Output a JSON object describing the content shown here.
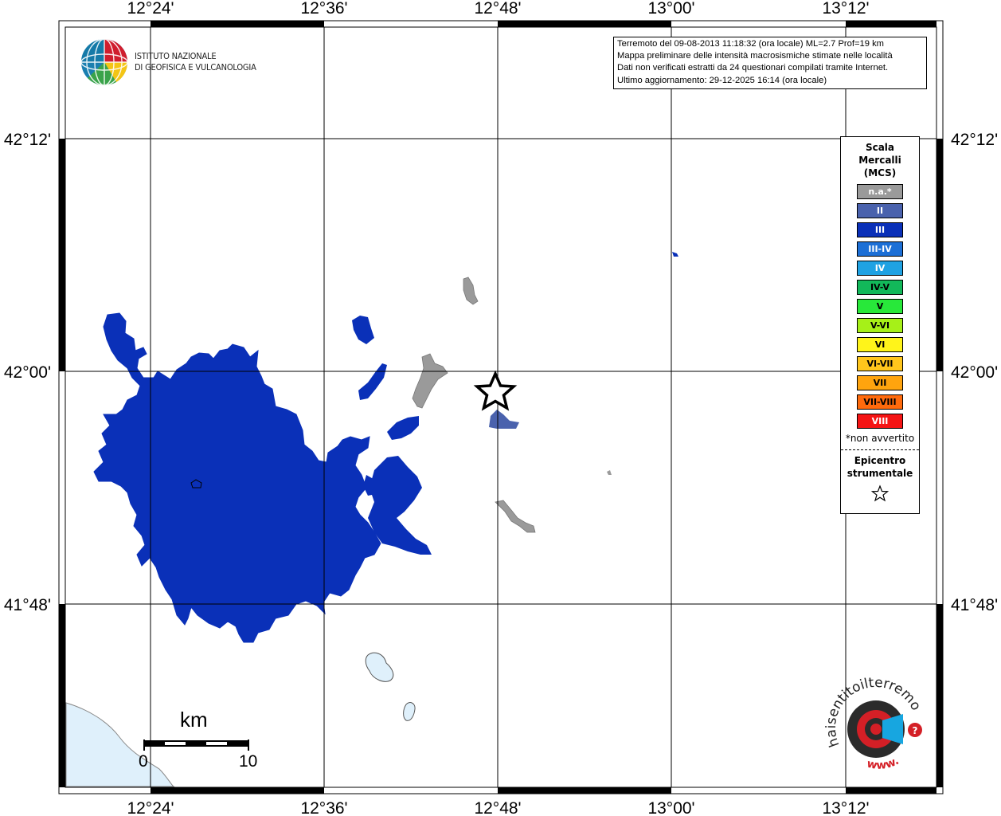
{
  "map": {
    "lon_labels": [
      "12°24'",
      "12°36'",
      "12°48'",
      "13°00'",
      "13°12'"
    ],
    "lat_labels": [
      "42°12'",
      "42°00'",
      "41°48'"
    ]
  },
  "logo": {
    "line1": "ISTITUTO NAZIONALE",
    "line2": "DI GEOFISICA E VULCANOLOGIA"
  },
  "info": {
    "line1": "Terremoto del 09-08-2013 11:18:32 (ora locale) ML=2.7 Prof=19 km",
    "line2": "Mappa preliminare delle intensità macrosismiche stimate nelle località",
    "line3": "Dati non verificati estratti da 24 questionari compilati tramite Internet.",
    "line4": "Ultimo aggiornamento: 29-12-2025 16:14 (ora locale)"
  },
  "legend": {
    "title_line1": "Scala",
    "title_line2": "Mercalli",
    "title_line3": "(MCS)",
    "items": [
      {
        "label": "n.a.*",
        "color": "#9a9a9a",
        "text_color": "#ffffff"
      },
      {
        "label": "II",
        "color": "#4a62ad",
        "text_color": "#ffffff"
      },
      {
        "label": "III",
        "color": "#0a30b8",
        "text_color": "#ffffff"
      },
      {
        "label": "III-IV",
        "color": "#1c6fd6",
        "text_color": "#ffffff"
      },
      {
        "label": "IV",
        "color": "#1fa2e3",
        "text_color": "#ffffff"
      },
      {
        "label": "IV-V",
        "color": "#12b85a",
        "text_color": "#000000"
      },
      {
        "label": "V",
        "color": "#28e83a",
        "text_color": "#000000"
      },
      {
        "label": "V-VI",
        "color": "#a6f018",
        "text_color": "#000000"
      },
      {
        "label": "VI",
        "color": "#fff41a",
        "text_color": "#000000"
      },
      {
        "label": "VI-VII",
        "color": "#ffc61c",
        "text_color": "#000000"
      },
      {
        "label": "VII",
        "color": "#ffa40e",
        "text_color": "#000000"
      },
      {
        "label": "VII-VIII",
        "color": "#ff6a0c",
        "text_color": "#000000"
      },
      {
        "label": "VIII",
        "color": "#f51414",
        "text_color": "#ffffff"
      }
    ],
    "note": "*non avvertito",
    "epicenter_line1": "Epicentro",
    "epicenter_line2": "strumentale"
  },
  "scale_bar": {
    "unit": "km",
    "start": "0",
    "end": "10"
  },
  "badge": {
    "text": "haisentitoilterremoto.it",
    "url_text": "www."
  },
  "colors": {
    "intensity_III": "#0a30b8",
    "intensity_II": "#4a62ad",
    "not_available": "#9a9a9a",
    "water": "#dff0fb",
    "epicenter_star": "#000000"
  }
}
